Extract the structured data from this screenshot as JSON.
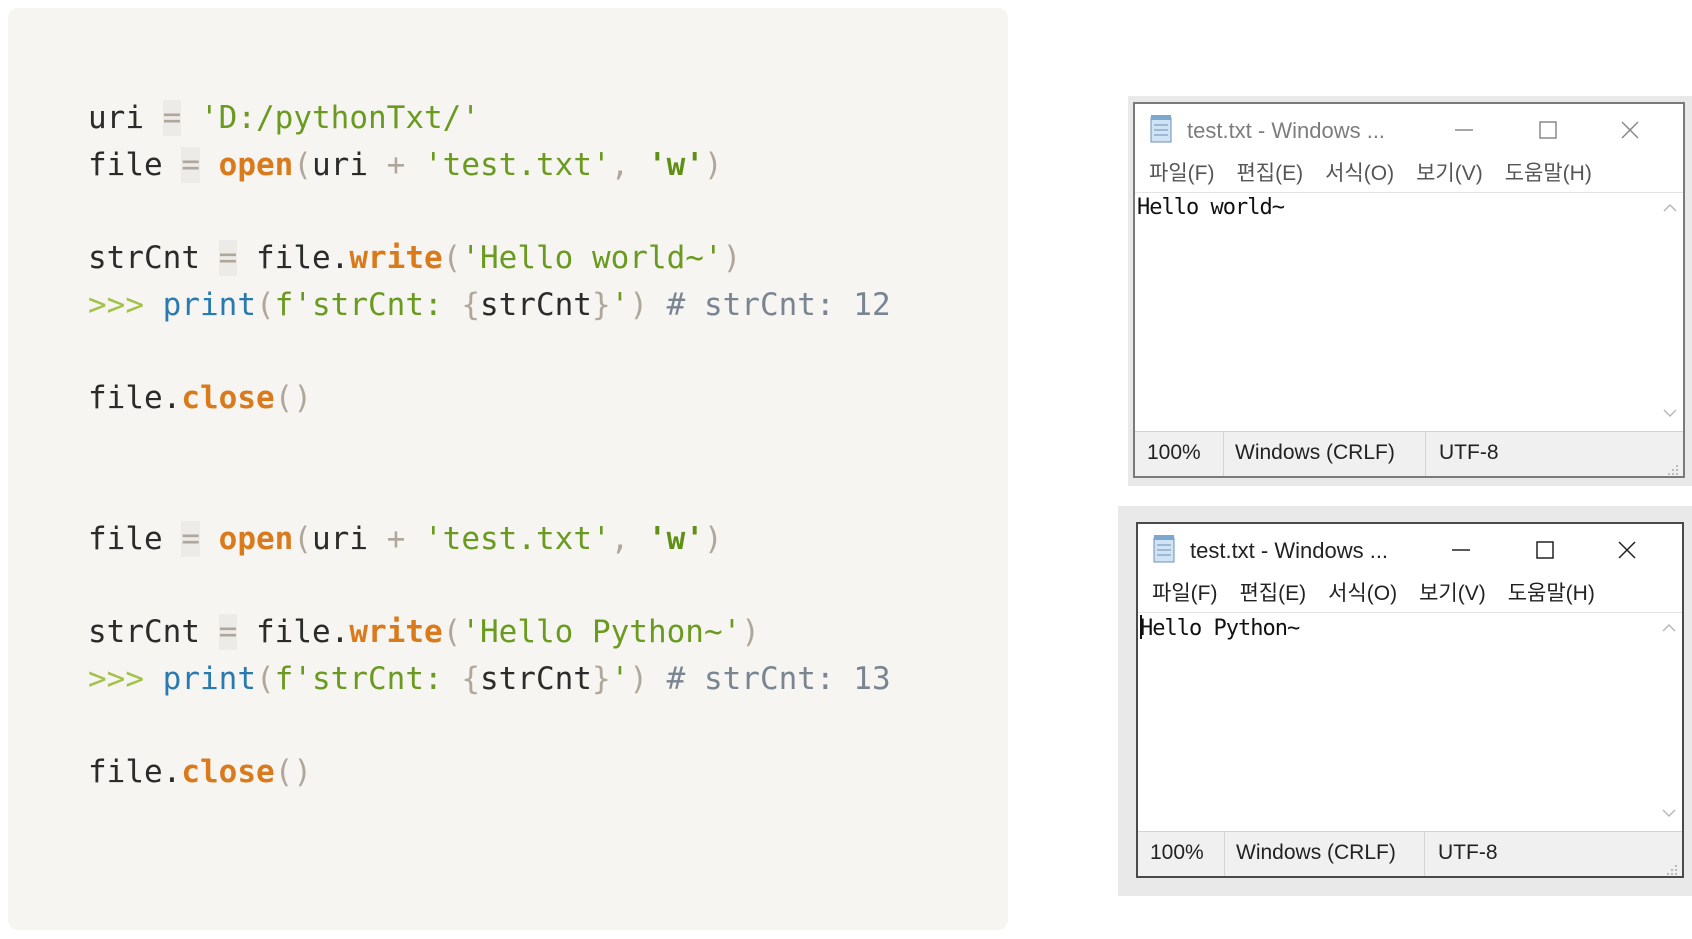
{
  "code": {
    "line1": {
      "v1": "uri",
      "eq": "=",
      "s1": "'D:/pythonTxt/'"
    },
    "line2": {
      "v1": "file",
      "eq": "=",
      "fn": "open",
      "p1": "(",
      "v2": "uri",
      "op": "+",
      "s1": "'test.txt'",
      "c": ",",
      "s2": "'w'",
      "p2": ")"
    },
    "line3": {
      "v1": "strCnt",
      "eq": "=",
      "obj": "file.",
      "fn": "write",
      "p1": "(",
      "s1": "'Hello world~'",
      "p2": ")"
    },
    "line4": {
      "pt": ">>>",
      "fn": "print",
      "p1": "(",
      "s1": "f'strCnt: ",
      "b1": "{",
      "v1": "strCnt",
      "b2": "}",
      "s2": "'",
      "p2": ")",
      "cm": "# strCnt: 12"
    },
    "line5": {
      "obj": "file.",
      "fn": "close",
      "p": "()"
    },
    "line6": {
      "v1": "file",
      "eq": "=",
      "fn": "open",
      "p1": "(",
      "v2": "uri",
      "op": "+",
      "s1": "'test.txt'",
      "c": ",",
      "s2": "'w'",
      "p2": ")"
    },
    "line7": {
      "v1": "strCnt",
      "eq": "=",
      "obj": "file.",
      "fn": "write",
      "p1": "(",
      "s1": "'Hello Python~'",
      "p2": ")"
    },
    "line8": {
      "pt": ">>>",
      "fn": "print",
      "p1": "(",
      "s1": "f'strCnt: ",
      "b1": "{",
      "v1": "strCnt",
      "b2": "}",
      "s2": "'",
      "p2": ")",
      "cm": "# strCnt: 13"
    },
    "line9": {
      "obj": "file.",
      "fn": "close",
      "p": "()"
    }
  },
  "notepad1": {
    "title": "test.txt - Windows ...",
    "menu": [
      "파일(F)",
      "편집(E)",
      "서식(O)",
      "보기(V)",
      "도움말(H)"
    ],
    "content": "Hello world~",
    "status": {
      "zoom": "100%",
      "eol": "Windows (CRLF)",
      "encoding": "UTF-8"
    }
  },
  "notepad2": {
    "title": "test.txt - Windows ...",
    "menu": [
      "파일(F)",
      "편집(E)",
      "서식(O)",
      "보기(V)",
      "도움말(H)"
    ],
    "content": "Hello Python~",
    "status": {
      "zoom": "100%",
      "eol": "Windows (CRLF)",
      "encoding": "UTF-8"
    }
  },
  "icons": {
    "notepad": "notepad-icon",
    "minimize": "minimize-icon",
    "maximize": "maximize-icon",
    "close": "close-icon",
    "scroll_up": "chevron-up-icon",
    "scroll_down": "chevron-down-icon",
    "grip": "resize-grip-icon"
  }
}
